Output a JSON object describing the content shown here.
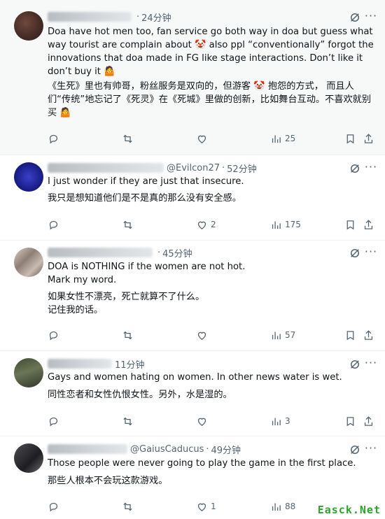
{
  "tweets": [
    {
      "handle": "",
      "time": "24分钟",
      "text": "Doa have hot men too, fan service go both way in doa but guess what way tourist are complain about 🤡 also ppl “conventionally” forgot the innovations that doa made in FG like stage interactions. Don’t like it don’t buy it 🤷",
      "translation": "《生死》里也有帅哥，粉丝服务是双向的，但游客 🤡 抱怨的方式， 而且人们“传统”地忘记了《死灵》在《死城》里做的创新，比如舞台互动。不喜欢就别买 🤷",
      "likes": "",
      "views": "25"
    },
    {
      "handle": "@Evilcon27",
      "time": "52分钟",
      "text": "I just wonder if they are just that insecure.",
      "translation": "我只是想知道他们是不是真的那么没有安全感。",
      "likes": "2",
      "views": "175"
    },
    {
      "handle": "",
      "time": "45分钟",
      "text": "DOA is NOTHING if the women are not hot.\nMark my word.",
      "translation": "如果女性不漂亮，死亡就算不了什么。\n记住我的话。",
      "likes": "",
      "views": "57"
    },
    {
      "handle": "",
      "time": "11分钟",
      "text": "Gays and women hating on women. In other news water is wet.",
      "translation": "同性恋者和女性仇恨女性。另外，水是湿的。",
      "likes": "",
      "views": "3"
    },
    {
      "handle": "@GaiusCaducus",
      "time": "49分钟",
      "text": "Those people were never going to play the game in the first place.",
      "translation": "那些人根本不会玩这款游戏。",
      "likes": "1",
      "views": "88"
    }
  ],
  "watermark": "Easck.Net",
  "colors": {
    "muted": "#536471",
    "text": "#0f1419",
    "first_bg": "#f7f9f9",
    "watermark": "#2aa52a"
  },
  "icons": [
    "grok-icon",
    "more-icon",
    "reply-icon",
    "retweet-icon",
    "like-icon",
    "views-icon",
    "bookmark-icon",
    "share-icon"
  ]
}
